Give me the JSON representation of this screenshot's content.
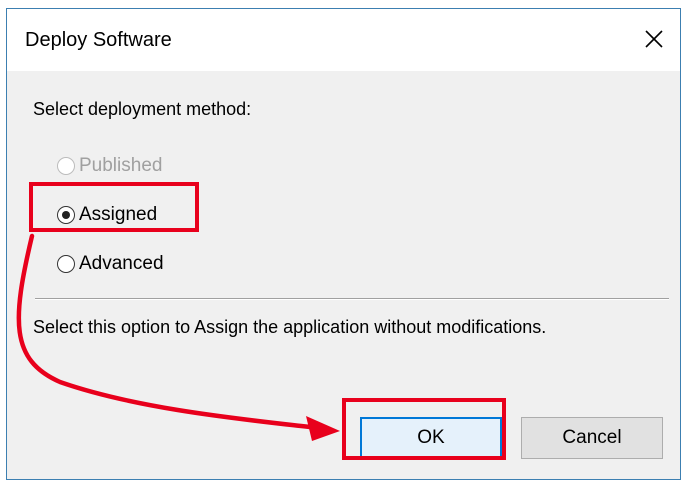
{
  "dialog": {
    "title": "Deploy Software",
    "prompt": "Select deployment method:",
    "options": [
      {
        "label": "Published",
        "checked": false,
        "disabled": true
      },
      {
        "label": "Assigned",
        "checked": true,
        "disabled": false
      },
      {
        "label": "Advanced",
        "checked": false,
        "disabled": false
      }
    ],
    "description": "Select this option to Assign the application without modifications.",
    "ok_label": "OK",
    "cancel_label": "Cancel"
  },
  "colors": {
    "annotation": "#e8001c",
    "title_border": "#3c7fb1",
    "default_button_border": "#0078d7",
    "dialog_background": "#f0f0f0"
  }
}
